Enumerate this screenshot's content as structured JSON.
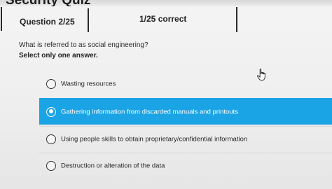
{
  "header": {
    "title_fragment": "Security Quiz",
    "question_counter": "Question 2/25",
    "score": "1/25 correct"
  },
  "question": {
    "text": "What is referred to as social engineering?",
    "instruction": "Select only one answer."
  },
  "options": [
    {
      "label": "Wasting resources",
      "selected": false
    },
    {
      "label": "Gathering information from discarded manuals and printouts",
      "selected": true
    },
    {
      "label": "Using people skills to obtain proprietary/confidential information",
      "selected": false
    },
    {
      "label": "Destruction or alteration of the data",
      "selected": false
    }
  ],
  "colors": {
    "accent": "#1aa3e5",
    "background": "#f0f0f0",
    "divider": "#2a2a2a"
  },
  "icons": {
    "cursor": "hand-pointer-icon",
    "radio_selected": "radio-checked-icon",
    "radio_unselected": "radio-unchecked-icon"
  }
}
